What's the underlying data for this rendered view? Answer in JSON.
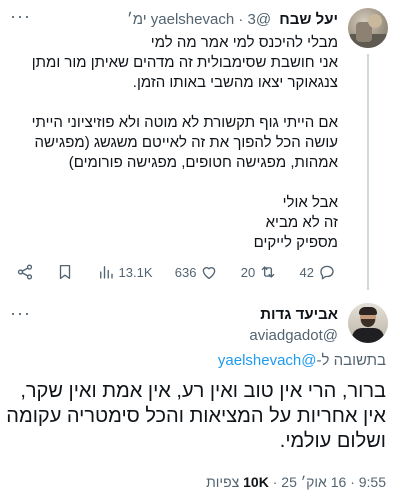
{
  "parent_tweet": {
    "name": "יעל שבח",
    "handle": "@yaelshevach",
    "dot": "·",
    "time": "3 ימ׳",
    "more": "···",
    "lines": [
      "מבלי להיכנס למי אמר מה למי",
      "אני חושבת שסימבולית זה מדהים שאיתן מור ומתן צנגאוקר יצאו מהשבי באותו הזמן."
    ],
    "lines2": [
      "אם הייתי גוף תקשורת לא מוטה ולא פוזיציוני הייתי עושה הכל להפוך את זה לאייטם משגשג (מפגישה אמהות, מפגישה חטופים, מפגישה פורומים)"
    ],
    "lines3": [
      "אבל אולי",
      "זה לא מביא",
      "מספיק לייקים"
    ],
    "actions": {
      "replies": "42",
      "retweets": "20",
      "likes": "636",
      "views": "13.1K"
    },
    "icons": [
      "reply-icon",
      "retweet-icon",
      "heart-icon",
      "views-chart-icon",
      "bookmark-icon",
      "share-icon"
    ]
  },
  "reply_tweet": {
    "name": "אביעד גדות",
    "handle": "@aviadgadot",
    "more": "···",
    "replying_prefix": "בתשובה ל-",
    "replying_handle": "@yaelshevach",
    "lines": [
      "ברור, הרי אין טוב ואין רע, אין אמת ואין שקר, אין אחריות על המציאות והכל סימטריה עקומה ושלום עולמי."
    ],
    "time": "9:55",
    "dot": "·",
    "date": "16 אוק׳ 25",
    "views_count": "10K",
    "views_label": "צפיות"
  },
  "colors": {
    "text": "#0f1419",
    "secondary": "#536471",
    "link": "#1d9bf0",
    "thread_line": "#cfd9de"
  }
}
